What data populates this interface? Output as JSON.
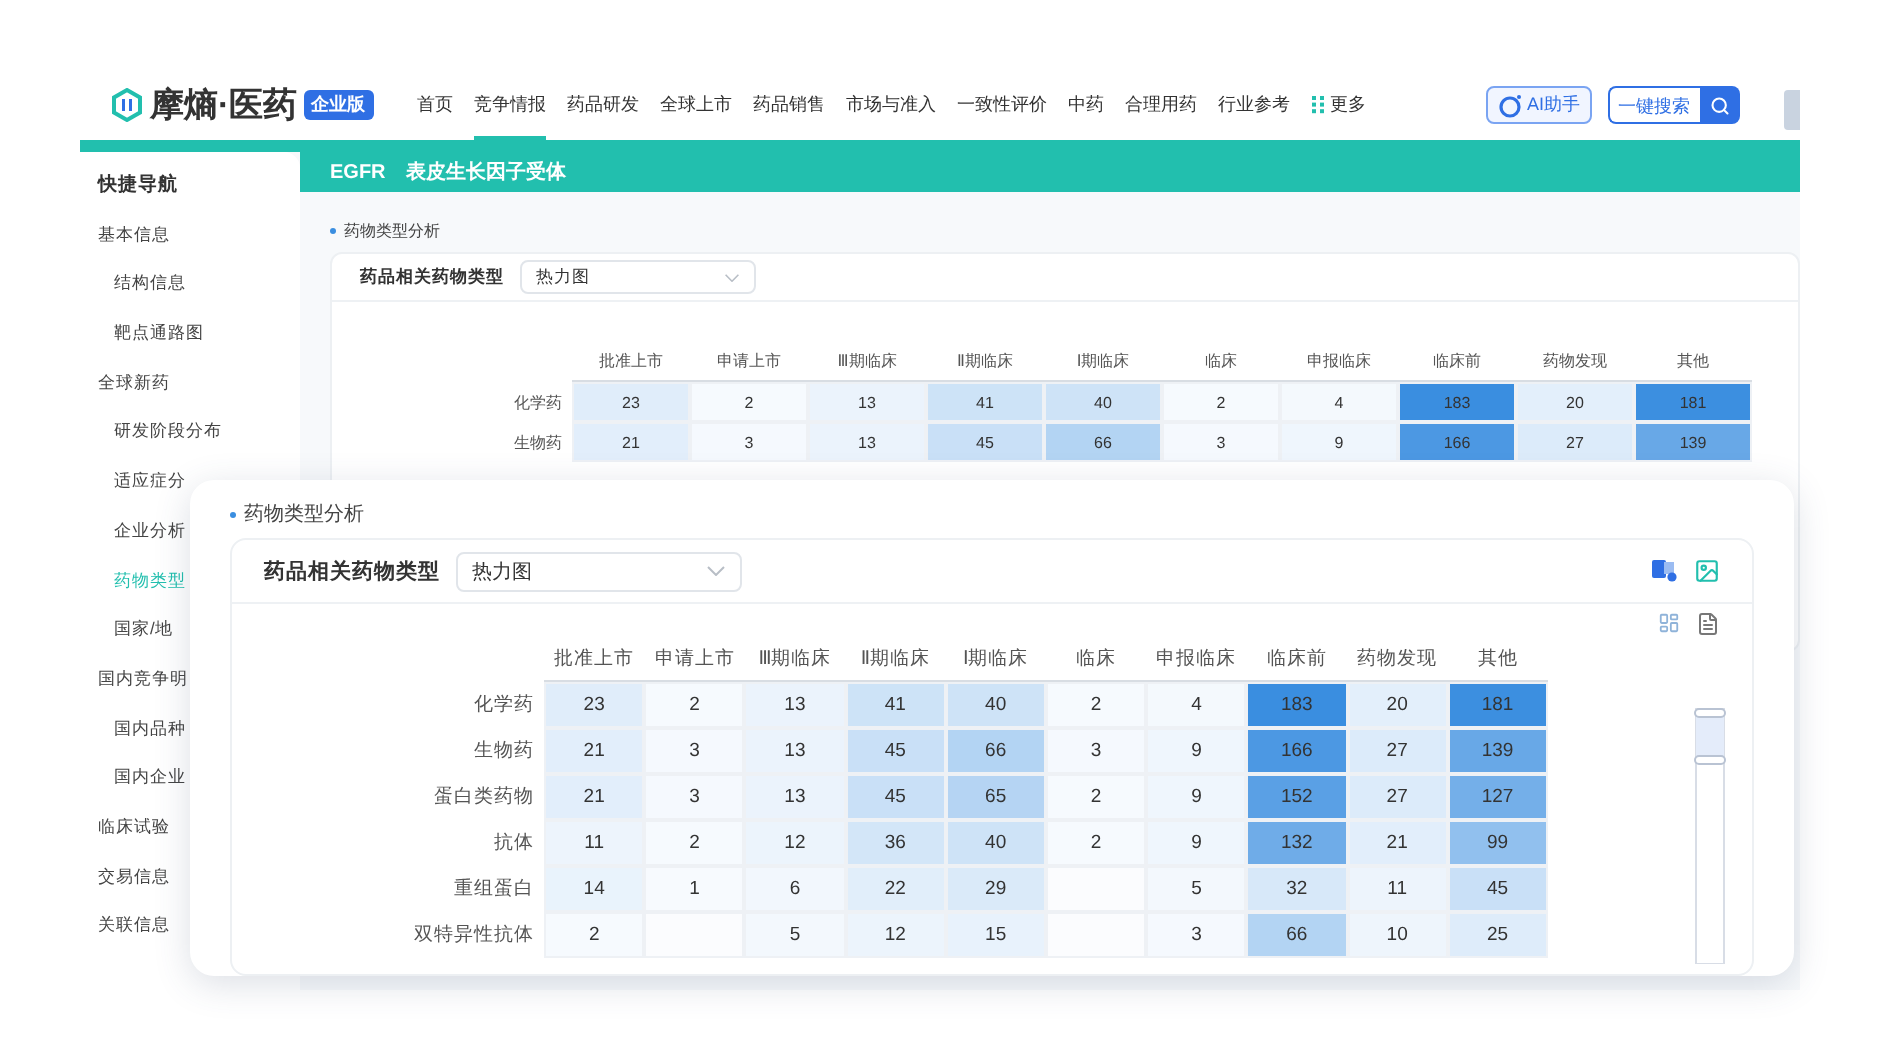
{
  "header": {
    "brand": "摩熵·医药",
    "badge": "企业版",
    "nav": [
      {
        "label": "首页",
        "selected": false
      },
      {
        "label": "竞争情报",
        "selected": true
      },
      {
        "label": "药品研发",
        "selected": false
      },
      {
        "label": "全球上市",
        "selected": false
      },
      {
        "label": "药品销售",
        "selected": false
      },
      {
        "label": "市场与准入",
        "selected": false
      },
      {
        "label": "一致性评价",
        "selected": false
      },
      {
        "label": "中药",
        "selected": false
      },
      {
        "label": "合理用药",
        "selected": false
      },
      {
        "label": "行业参考",
        "selected": false
      }
    ],
    "more": "更多",
    "ai_button": "AI助手",
    "search": {
      "placeholder": "一键搜索"
    }
  },
  "sidebar": {
    "title": "快捷导航",
    "items": [
      {
        "label": "基本信息",
        "selected": false,
        "children": [
          {
            "label": "结构信息",
            "selected": false
          },
          {
            "label": "靶点通路图",
            "selected": false
          }
        ]
      },
      {
        "label": "全球新药",
        "selected": false,
        "children": [
          {
            "label": "研发阶段分布",
            "selected": false
          },
          {
            "label": "适应症分",
            "selected": false
          },
          {
            "label": "企业分析",
            "selected": false
          },
          {
            "label": "药物类型",
            "selected": true
          },
          {
            "label": "国家/地",
            "selected": false
          }
        ]
      },
      {
        "label": "国内竞争明",
        "selected": false,
        "children": [
          {
            "label": "国内品种",
            "selected": false
          },
          {
            "label": "国内企业",
            "selected": false
          }
        ]
      },
      {
        "label": "临床试验",
        "selected": false
      },
      {
        "label": "交易信息",
        "selected": false
      },
      {
        "label": "关联信息",
        "selected": false
      }
    ]
  },
  "page_title": {
    "code": "EGFR",
    "name": "表皮生长因子受体"
  },
  "back_panel": {
    "section_title": "药物类型分析",
    "filter_label": "药品相关药物类型",
    "select_value": "热力图",
    "heatmap": {
      "columns": [
        "批准上市",
        "申请上市",
        "Ⅲ期临床",
        "Ⅱ期临床",
        "Ⅰ期临床",
        "临床",
        "申报临床",
        "临床前",
        "药物发现",
        "其他"
      ],
      "rows": [
        {
          "label": "化学药",
          "cells": [
            "23",
            "2",
            "13",
            "41",
            "40",
            "2",
            "4",
            "183",
            "20",
            "181"
          ]
        },
        {
          "label": "生物药",
          "cells": [
            "21",
            "3",
            "13",
            "45",
            "66",
            "3",
            "9",
            "166",
            "27",
            "139"
          ]
        }
      ]
    }
  },
  "front_panel": {
    "section_title": "药物类型分析",
    "filter_label": "药品相关药物类型",
    "select_value": "热力图",
    "heatmap": {
      "columns": [
        "批准上市",
        "申请上市",
        "Ⅲ期临床",
        "Ⅱ期临床",
        "Ⅰ期临床",
        "临床",
        "申报临床",
        "临床前",
        "药物发现",
        "其他"
      ],
      "rows": [
        {
          "label": "化学药",
          "cells": [
            "23",
            "2",
            "13",
            "41",
            "40",
            "2",
            "4",
            "183",
            "20",
            "181"
          ]
        },
        {
          "label": "生物药",
          "cells": [
            "21",
            "3",
            "13",
            "45",
            "66",
            "3",
            "9",
            "166",
            "27",
            "139"
          ]
        },
        {
          "label": "蛋白类药物",
          "cells": [
            "21",
            "3",
            "13",
            "45",
            "65",
            "2",
            "9",
            "152",
            "27",
            "127"
          ]
        },
        {
          "label": "抗体",
          "cells": [
            "11",
            "2",
            "12",
            "36",
            "40",
            "2",
            "9",
            "132",
            "21",
            "99"
          ]
        },
        {
          "label": "重组蛋白",
          "cells": [
            "14",
            "1",
            "6",
            "22",
            "29",
            null,
            "5",
            "32",
            "11",
            "45"
          ]
        },
        {
          "label": "双特异性抗体",
          "cells": [
            "2",
            null,
            "5",
            "12",
            "15",
            null,
            "3",
            "66",
            "10",
            "25"
          ]
        }
      ]
    }
  }
}
